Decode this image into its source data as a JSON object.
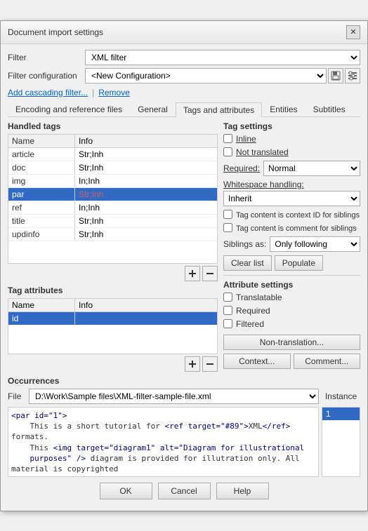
{
  "dialog": {
    "title": "Document import settings",
    "close_label": "✕"
  },
  "filter": {
    "label": "Filter",
    "value": "XML filter"
  },
  "filter_config": {
    "label": "Filter configuration",
    "value": "<New Configuration>",
    "save_icon": "💾",
    "config_icon": "⚙"
  },
  "links": {
    "add_cascading": "Add cascading filter...",
    "separator": "|",
    "remove": "Remove"
  },
  "tabs": [
    {
      "label": "Encoding and reference files",
      "active": false
    },
    {
      "label": "General",
      "active": false
    },
    {
      "label": "Tags and attributes",
      "active": true
    },
    {
      "label": "Entities",
      "active": false
    },
    {
      "label": "Subtitles",
      "active": false
    }
  ],
  "handled_tags": {
    "title": "Handled tags",
    "columns": [
      "Name",
      "Info"
    ],
    "rows": [
      {
        "name": "article",
        "info": "Str;Inh",
        "selected": false
      },
      {
        "name": "doc",
        "info": "Str;Inh",
        "selected": false
      },
      {
        "name": "img",
        "info": "In;Inh",
        "selected": false
      },
      {
        "name": "par",
        "info": "Str;Inh",
        "selected": true
      },
      {
        "name": "ref",
        "info": "In;Inh",
        "selected": false
      },
      {
        "name": "title",
        "info": "Str;Inh",
        "selected": false
      },
      {
        "name": "updinfo",
        "info": "Str;Inh",
        "selected": false
      }
    ],
    "add_icon": "+",
    "remove_icon": "−"
  },
  "tag_settings": {
    "title": "Tag settings",
    "inline_label": "Inline",
    "not_translated_label": "Not translated",
    "required_label": "Required:",
    "required_value": "Normal",
    "whitespace_label": "Whitespace handling:",
    "whitespace_value": "Inherit",
    "context_id_label": "Tag content is context ID for siblings",
    "comment_label": "Tag content is comment for siblings",
    "siblings_label": "Siblings as:",
    "siblings_value": "Only following",
    "clear_list_label": "Clear list",
    "populate_label": "Populate"
  },
  "tag_attributes": {
    "title": "Tag attributes",
    "columns": [
      "Name",
      "Info"
    ],
    "rows": [
      {
        "name": "id",
        "info": "",
        "selected": true
      }
    ],
    "add_icon": "+",
    "remove_icon": "−"
  },
  "attribute_settings": {
    "title": "Attribute settings",
    "translatable_label": "Translatable",
    "required_label": "Required",
    "filtered_label": "Filtered",
    "non_translation_label": "Non-translation...",
    "context_label": "Context...",
    "comment_label": "Comment..."
  },
  "occurrences": {
    "title": "Occurrences",
    "file_label": "File",
    "file_value": "D:\\Work\\Sample files\\XML-filter-sample-file.xml",
    "instance_label": "Instance",
    "preview_text": "<par id=\"1\">\n    This is a short tutorial for <ref target=\"#89\">XML</ref> formats.\n    This <img target=\"diagram1\" alt=\"Diagram for illustrational\n    purposes\" /> diagram is provided for illutration only. All material is copyrighted\n    (&copyright;).\n        </par>",
    "instances": [
      "1"
    ]
  },
  "buttons": {
    "ok": "OK",
    "cancel": "Cancel",
    "help": "Help"
  }
}
